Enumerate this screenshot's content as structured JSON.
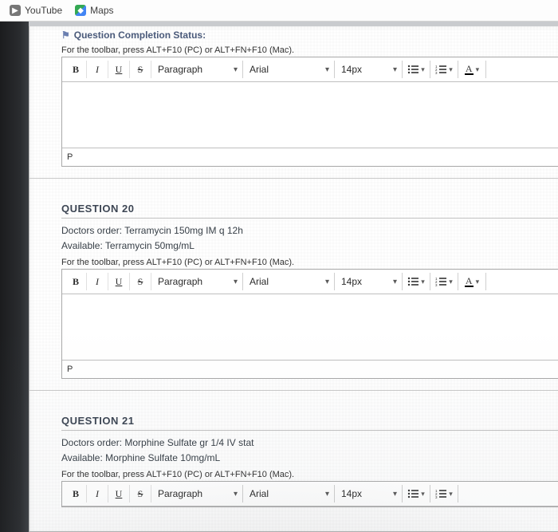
{
  "bookmarks": [
    {
      "label": "YouTube",
      "icon": "youtube-icon"
    },
    {
      "label": "Maps",
      "icon": "maps-icon"
    }
  ],
  "top": {
    "completion_status_label": "Question Completion Status:"
  },
  "editor_common": {
    "hint": "For the toolbar, press ALT+F10 (PC) or ALT+FN+F10 (Mac).",
    "bold": "B",
    "italic": "I",
    "underline": "U",
    "strike": "S",
    "paragraph": "Paragraph",
    "font": "Arial",
    "font_size": "14px",
    "text_color_label": "A",
    "status_p": "P"
  },
  "q20": {
    "heading": "QUESTION 20",
    "line1": "Doctors order:  Terramycin 150mg IM q 12h",
    "line2": "Available:  Terramycin 50mg/mL"
  },
  "q21": {
    "heading": "QUESTION 21",
    "line1": "Doctors order:  Morphine Sulfate gr 1/4 IV stat",
    "line2": "Available:  Morphine Sulfate 10mg/mL"
  }
}
